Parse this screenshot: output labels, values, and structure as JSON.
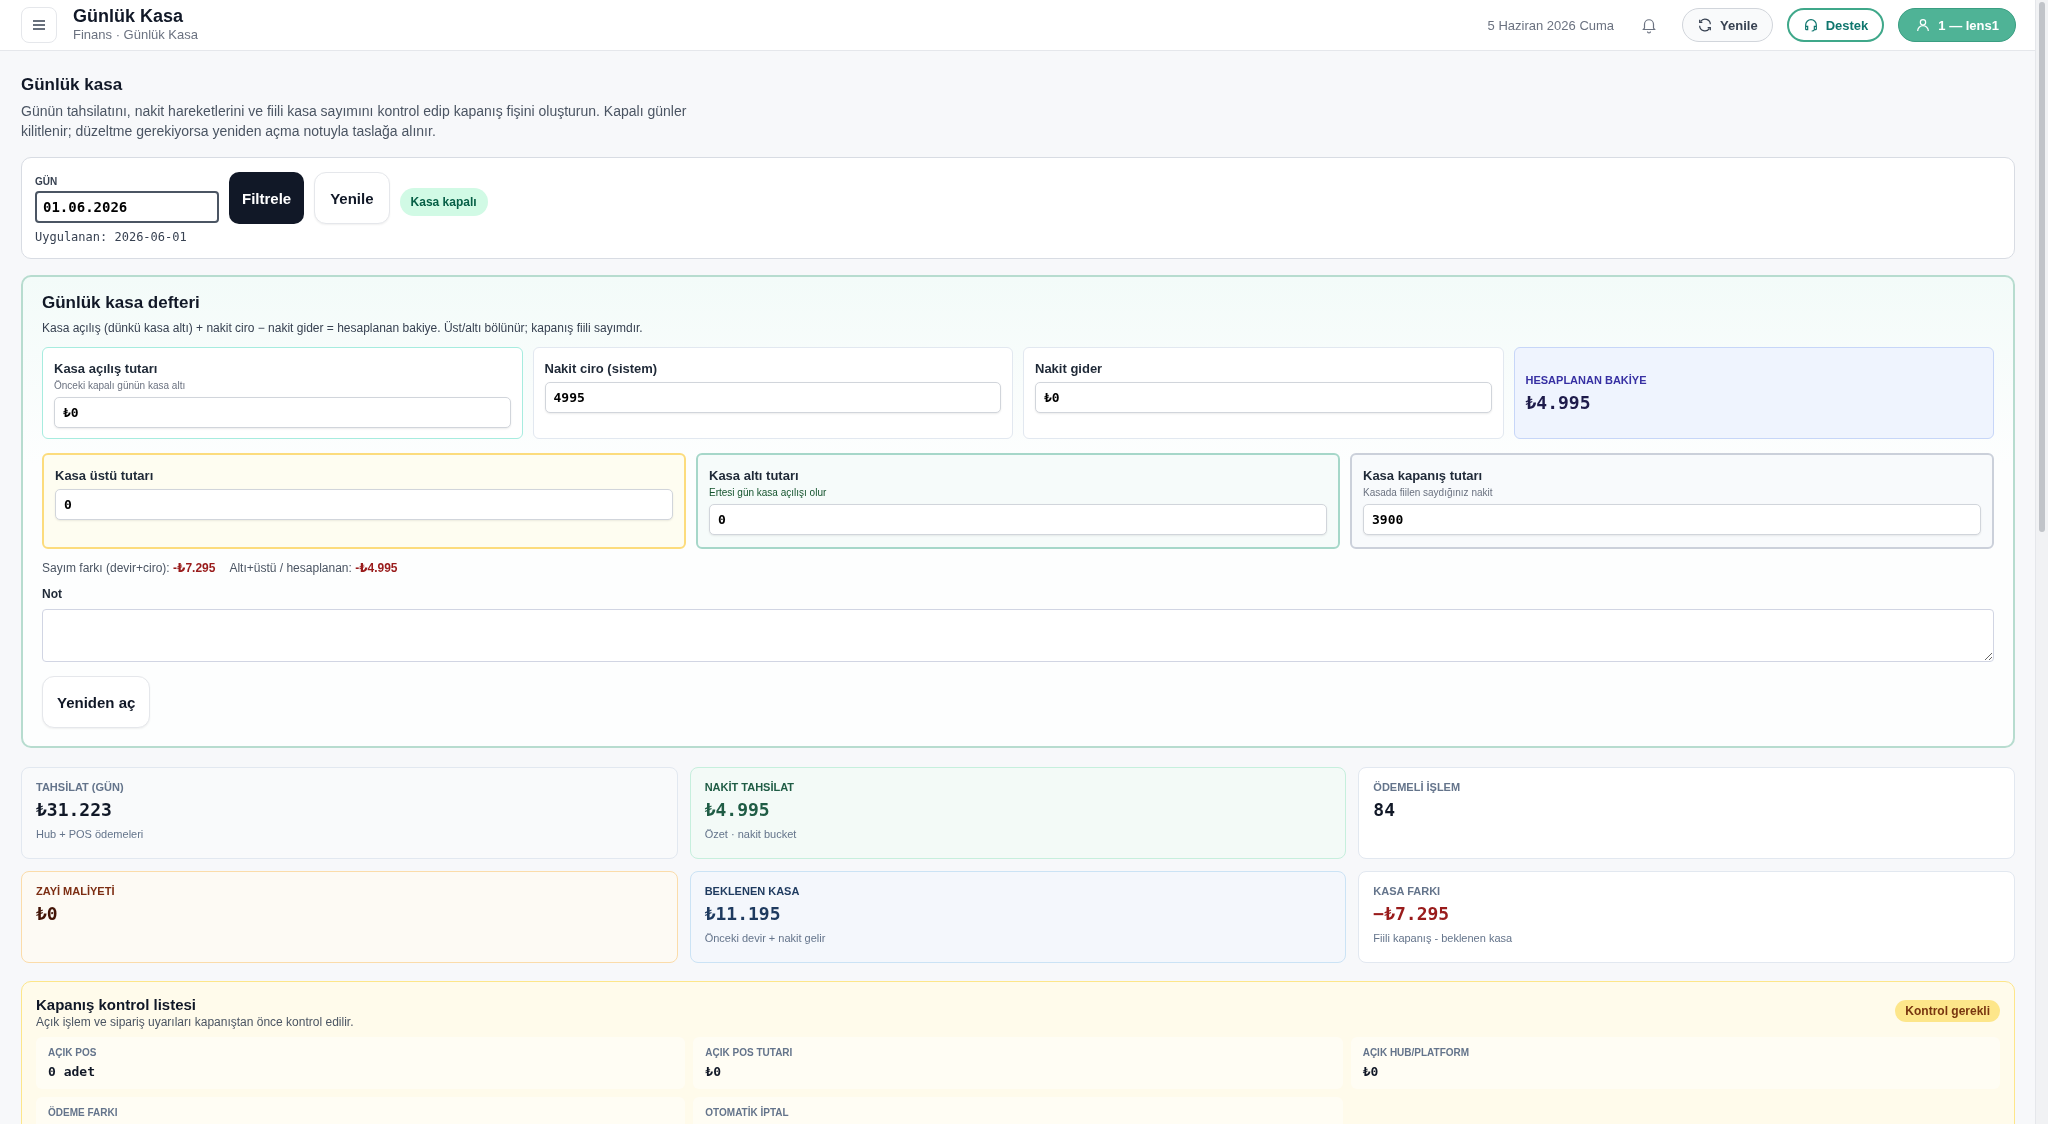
{
  "header": {
    "title": "Günlük Kasa",
    "breadcrumb": "Finans · Günlük Kasa",
    "date": "5 Haziran 2026 Cuma",
    "refresh": "Yenile",
    "support": "Destek",
    "user": "1 — lens1"
  },
  "page": {
    "title": "Günlük kasa",
    "description": "Günün tahsilatını, nakit hareketlerini ve fiili kasa sayımını kontrol edip kapanış fişini oluşturun. Kapalı günler kilitlenir; düzeltme gerekiyorsa yeniden açma notuyla taslağa alınır."
  },
  "filter": {
    "label": "GÜN",
    "value": "01.06.2026",
    "filter_button": "Filtrele",
    "refresh_button": "Yenile",
    "status": "Kasa kapalı",
    "applied": "Uygulanan: 2026-06-01"
  },
  "ledger": {
    "title": "Günlük kasa defteri",
    "subtitle": "Kasa açılış (dünkü kasa altı) + nakit ciro − nakit gider = hesaplanan bakiye. Üst/altı bölünür; kapanış fiili sayımdır.",
    "top": [
      {
        "kind": "teal",
        "label": "Kasa açılış tutarı",
        "hint": "Önceki kapalı günün kasa altı",
        "value": "₺0"
      },
      {
        "kind": "plain",
        "label": "Nakit ciro (sistem)",
        "value": "4995"
      },
      {
        "kind": "plain",
        "label": "Nakit gider",
        "value": "₺0"
      },
      {
        "kind": "total",
        "label": "HESAPLANAN BAKİYE",
        "value": "₺4.995"
      }
    ],
    "bottom": [
      {
        "kind": "yellow",
        "label": "Kasa üstü tutarı",
        "value": "0"
      },
      {
        "kind": "green",
        "label": "Kasa altı tutarı",
        "hint": "Ertesi gün kasa açılışı olur",
        "value": "0"
      },
      {
        "kind": "gray",
        "label": "Kasa kapanış tutarı",
        "hint": "Kasada fiilen saydığınız nakit",
        "value": "3900"
      }
    ],
    "diffs": [
      {
        "label": "Sayım farkı (devir+ciro):",
        "value": "-₺7.295"
      },
      {
        "label": "Altı+üstü / hesaplanan:",
        "value": "-₺4.995"
      }
    ],
    "note_label": "Not",
    "reopen_button": "Yeniden aç"
  },
  "stats": [
    {
      "kind": "plain",
      "label": "TAHSİLAT (GÜN)",
      "value": "₺31.223",
      "note": "Hub + POS ödemeleri"
    },
    {
      "kind": "green",
      "label": "NAKİT TAHSİLAT",
      "value": "₺4.995",
      "note": "Özet · nakit bucket"
    },
    {
      "kind": "white",
      "label": "ÖDEMELİ İŞLEM",
      "value": "84"
    },
    {
      "kind": "orange",
      "label": "ZAYİ MALİYETİ",
      "value": "₺0"
    },
    {
      "kind": "blue",
      "label": "BEKLENEN KASA",
      "value": "₺11.195",
      "note": "Önceki devir + nakit gelir"
    },
    {
      "kind": "alert",
      "label": "KASA FARKI",
      "value": "−₺7.295",
      "note": "Fiili kapanış - beklenen kasa"
    }
  ],
  "checklist": {
    "title": "Kapanış kontrol listesi",
    "subtitle": "Açık işlem ve sipariş uyarıları kapanıştan önce kontrol edilir.",
    "badge": "Kontrol gerekli",
    "items": [
      {
        "label": "AÇIK POS",
        "value": "0 adet"
      },
      {
        "label": "AÇIK POS TUTARI",
        "value": "₺0"
      },
      {
        "label": "AÇIK HUB/PLATFORM",
        "value": "₺0"
      },
      {
        "label": "ÖDEME FARKI"
      },
      {
        "label": "OTOMATİK İPTAL"
      }
    ]
  }
}
